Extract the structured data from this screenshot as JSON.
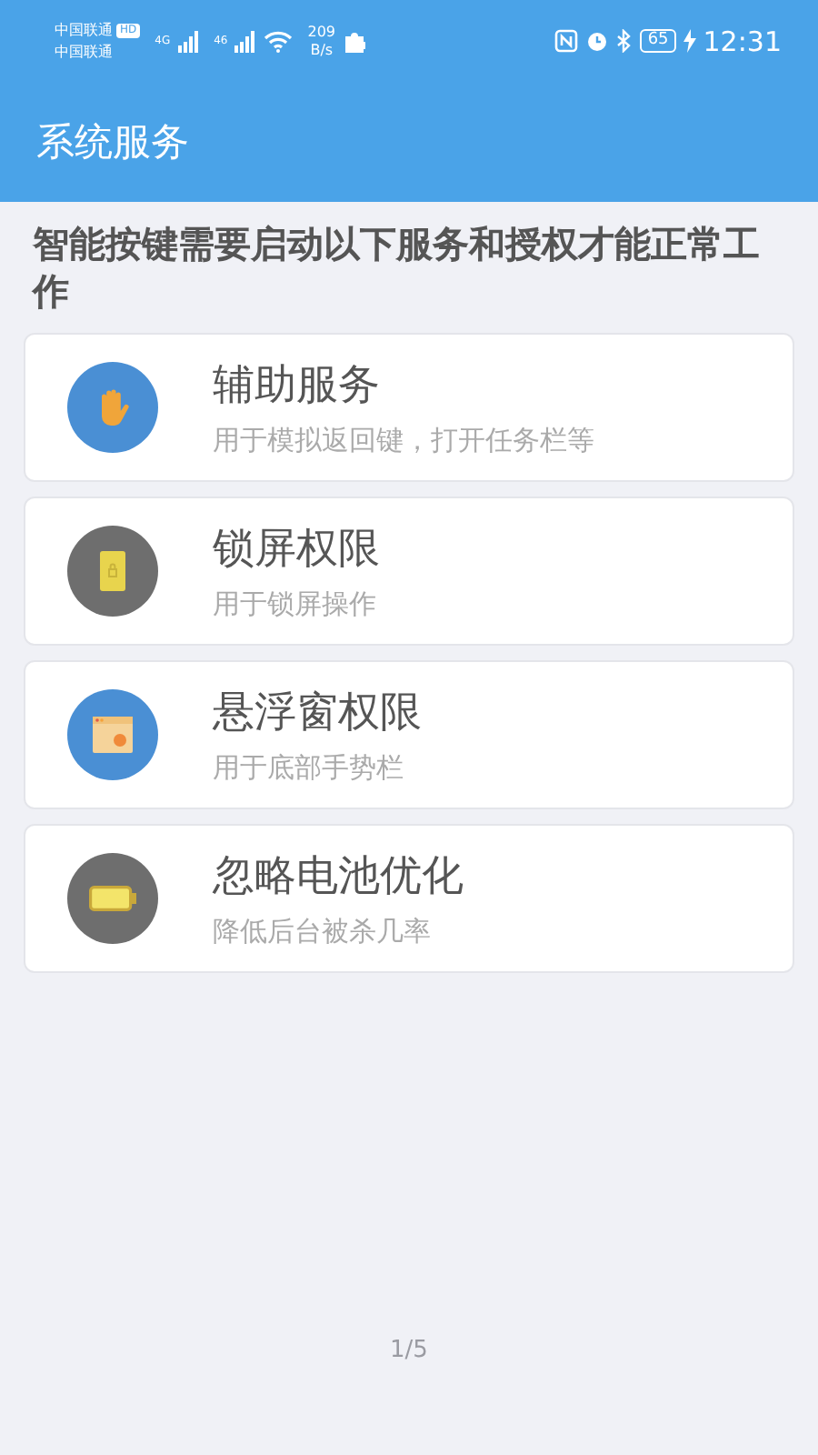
{
  "status_bar": {
    "carrier_1": "中国联通",
    "hd_badge": "HD",
    "carrier_2": "中国联通",
    "network_1": "4G",
    "network_2": "46",
    "speed_value": "209",
    "speed_unit": "B/s",
    "battery": "65",
    "time": "12:31"
  },
  "app_bar": {
    "title": "系统服务"
  },
  "intro": "智能按键需要启动以下服务和授权才能正常工作",
  "services": [
    {
      "kind": "hand",
      "color": "#4a8fd4",
      "title": "辅助服务",
      "description": "用于模拟返回键，打开任务栏等"
    },
    {
      "kind": "lock",
      "color": "#6e6e6e",
      "title": "锁屏权限",
      "description": "用于锁屏操作"
    },
    {
      "kind": "window",
      "color": "#4a8fd4",
      "title": "悬浮窗权限",
      "description": "用于底部手势栏"
    },
    {
      "kind": "battery",
      "color": "#6e6e6e",
      "title": "忽略电池优化",
      "description": "降低后台被杀几率"
    }
  ],
  "page_indicator": "1/5"
}
